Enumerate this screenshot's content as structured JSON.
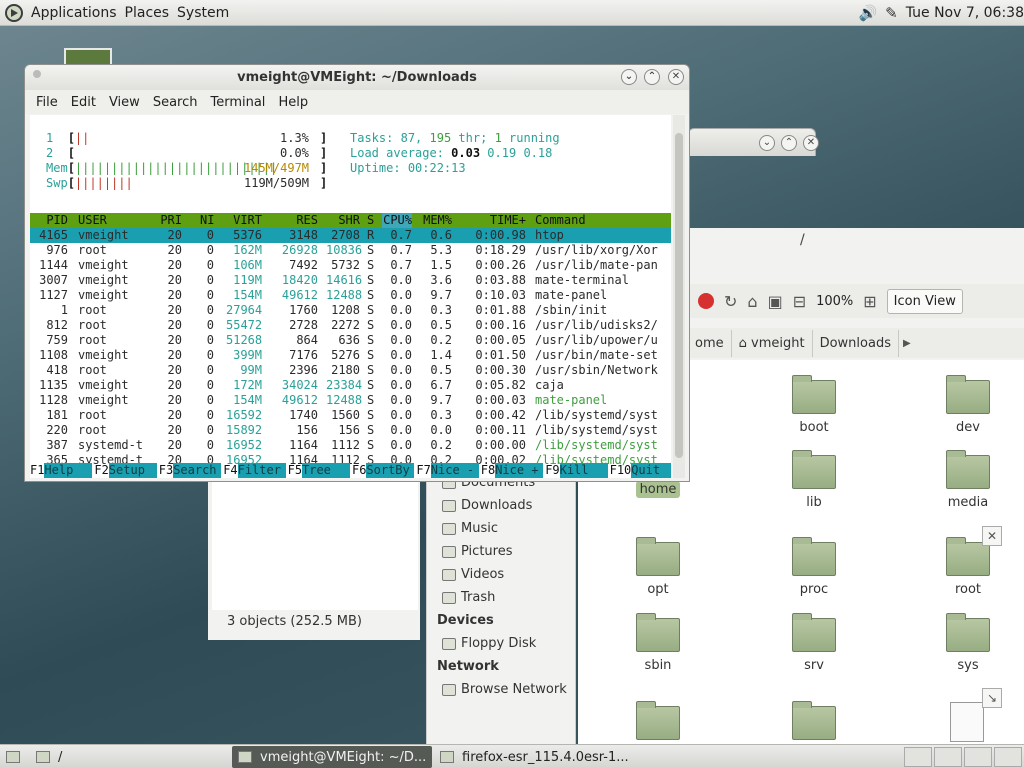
{
  "top_panel": {
    "menus": [
      "Applications",
      "Places",
      "System"
    ],
    "clock": "Tue Nov  7, 06:38"
  },
  "terminal": {
    "title": "vmeight@VMEight: ~/Downloads",
    "menus": [
      "File",
      "Edit",
      "View",
      "Search",
      "Terminal",
      "Help"
    ],
    "htop": {
      "cpu1_num": "1",
      "cpu1_bar": "||",
      "cpu1_pct": "1.3%",
      "cpu2_num": "2",
      "cpu2_bar": "",
      "cpu2_pct": "0.0%",
      "mem_label": "Mem",
      "mem_bar": "||||||||||||||||||||||||||||",
      "mem_value": "145M/497M",
      "swp_label": "Swp",
      "swp_bar": "||||||||",
      "swp_value": "119M/509M",
      "tasks_label": "Tasks:",
      "tasks": "87",
      "thr": "195",
      "thr_label": "thr;",
      "running": "1",
      "running_label": "running",
      "load_label": "Load average:",
      "load1": "0.03",
      "load5": "0.19",
      "load15": "0.18",
      "uptime_label": "Uptime:",
      "uptime": "00:22:13",
      "columns": [
        "PID",
        "USER",
        "PRI",
        "NI",
        "VIRT",
        "RES",
        "SHR",
        "S",
        "CPU%",
        "MEM%",
        "TIME+",
        "Command"
      ],
      "rows": [
        [
          "4165",
          "vmeight",
          "20",
          "0",
          "5376",
          "3148",
          "2708",
          "R",
          "0.7",
          "0.6",
          "0:00.98",
          "htop"
        ],
        [
          "976",
          "root",
          "20",
          "0",
          "162M",
          "26928",
          "10836",
          "S",
          "0.7",
          "5.3",
          "0:18.29",
          "/usr/lib/xorg/Xor"
        ],
        [
          "1144",
          "vmeight",
          "20",
          "0",
          "106M",
          "7492",
          "5732",
          "S",
          "0.7",
          "1.5",
          "0:00.26",
          "/usr/lib/mate-pan"
        ],
        [
          "3007",
          "vmeight",
          "20",
          "0",
          "119M",
          "18420",
          "14616",
          "S",
          "0.0",
          "3.6",
          "0:03.88",
          "mate-terminal"
        ],
        [
          "1127",
          "vmeight",
          "20",
          "0",
          "154M",
          "49612",
          "12488",
          "S",
          "0.0",
          "9.7",
          "0:10.03",
          "mate-panel"
        ],
        [
          "1",
          "root",
          "20",
          "0",
          "27964",
          "1760",
          "1208",
          "S",
          "0.0",
          "0.3",
          "0:01.88",
          "/sbin/init"
        ],
        [
          "812",
          "root",
          "20",
          "0",
          "55472",
          "2728",
          "2272",
          "S",
          "0.0",
          "0.5",
          "0:00.16",
          "/usr/lib/udisks2/"
        ],
        [
          "759",
          "root",
          "20",
          "0",
          "51268",
          "864",
          "636",
          "S",
          "0.0",
          "0.2",
          "0:00.05",
          "/usr/lib/upower/u"
        ],
        [
          "1108",
          "vmeight",
          "20",
          "0",
          "399M",
          "7176",
          "5276",
          "S",
          "0.0",
          "1.4",
          "0:01.50",
          "/usr/bin/mate-set"
        ],
        [
          "418",
          "root",
          "20",
          "0",
          "99M",
          "2396",
          "2180",
          "S",
          "0.0",
          "0.5",
          "0:00.30",
          "/usr/sbin/Network"
        ],
        [
          "1135",
          "vmeight",
          "20",
          "0",
          "172M",
          "34024",
          "23384",
          "S",
          "0.0",
          "6.7",
          "0:05.82",
          "caja"
        ],
        [
          "1128",
          "vmeight",
          "20",
          "0",
          "154M",
          "49612",
          "12488",
          "S",
          "0.0",
          "9.7",
          "0:00.03",
          "mate-panel"
        ],
        [
          "181",
          "root",
          "20",
          "0",
          "16592",
          "1740",
          "1560",
          "S",
          "0.0",
          "0.3",
          "0:00.42",
          "/lib/systemd/syst"
        ],
        [
          "220",
          "root",
          "20",
          "0",
          "15892",
          "156",
          "156",
          "S",
          "0.0",
          "0.0",
          "0:00.11",
          "/lib/systemd/syst"
        ],
        [
          "387",
          "systemd-t",
          "20",
          "0",
          "16952",
          "1164",
          "1112",
          "S",
          "0.0",
          "0.2",
          "0:00.00",
          "/lib/systemd/syst"
        ],
        [
          "365",
          "systemd-t",
          "20",
          "0",
          "16952",
          "1164",
          "1112",
          "S",
          "0.0",
          "0.2",
          "0:00.02",
          "/lib/systemd/syst"
        ]
      ],
      "footer": [
        {
          "key": "F1",
          "label": "Help  "
        },
        {
          "key": "F2",
          "label": "Setup "
        },
        {
          "key": "F3",
          "label": "Search"
        },
        {
          "key": "F4",
          "label": "Filter"
        },
        {
          "key": "F5",
          "label": "Tree  "
        },
        {
          "key": "F6",
          "label": "SortBy"
        },
        {
          "key": "F7",
          "label": "Nice -"
        },
        {
          "key": "F8",
          "label": "Nice +"
        },
        {
          "key": "F9",
          "label": "Kill  "
        },
        {
          "key": "F10",
          "label": "Quit "
        }
      ]
    }
  },
  "file_manager": {
    "location_slash": "/",
    "zoom": "100%",
    "view_mode": "Icon View",
    "breadcrumbs": [
      "ome",
      "vmeight",
      "Downloads"
    ],
    "status": "3 objects (252.5 MB)",
    "sidebar": {
      "places": [
        "Documents",
        "Downloads",
        "Music",
        "Pictures",
        "Videos",
        "Trash"
      ],
      "devices_heading": "Devices",
      "devices": [
        "Floppy Disk"
      ],
      "network_heading": "Network",
      "network": [
        "Browse Network"
      ]
    },
    "folders": [
      "boot",
      "dev",
      "home",
      "lib",
      "media",
      "opt",
      "proc",
      "root",
      "sbin",
      "srv",
      "sys"
    ]
  },
  "taskbar": {
    "items": [
      "/",
      "vmeight@VMEight: ~/D...",
      "firefox-esr_115.4.0esr-1..."
    ]
  }
}
